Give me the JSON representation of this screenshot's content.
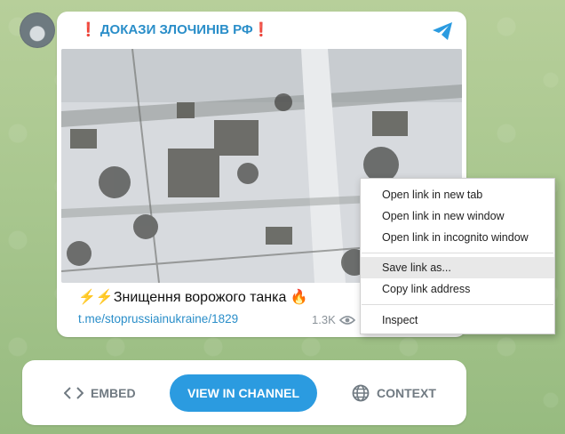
{
  "post": {
    "title": "❗ ДОКАЗИ ЗЛОЧИНІВ РФ❗",
    "caption": "⚡⚡Знищення ворожого танка 🔥",
    "link": "t.me/stoprussiainukraine/1829",
    "views": "1.3K"
  },
  "context_menu": {
    "items": [
      "Open link in new tab",
      "Open link in new window",
      "Open link in incognito window",
      "Save link as...",
      "Copy link address",
      "Inspect"
    ],
    "highlighted": "Save link as..."
  },
  "actions": {
    "embed_label": "EMBED",
    "view_channel_label": "VIEW IN CHANNEL",
    "context_label": "CONTEXT"
  },
  "colors": {
    "accent": "#2b9be0",
    "title": "#2a8ec9",
    "muted": "#707a82"
  },
  "icons": [
    "share-icon",
    "eye-icon",
    "code-icon",
    "globe-icon"
  ]
}
